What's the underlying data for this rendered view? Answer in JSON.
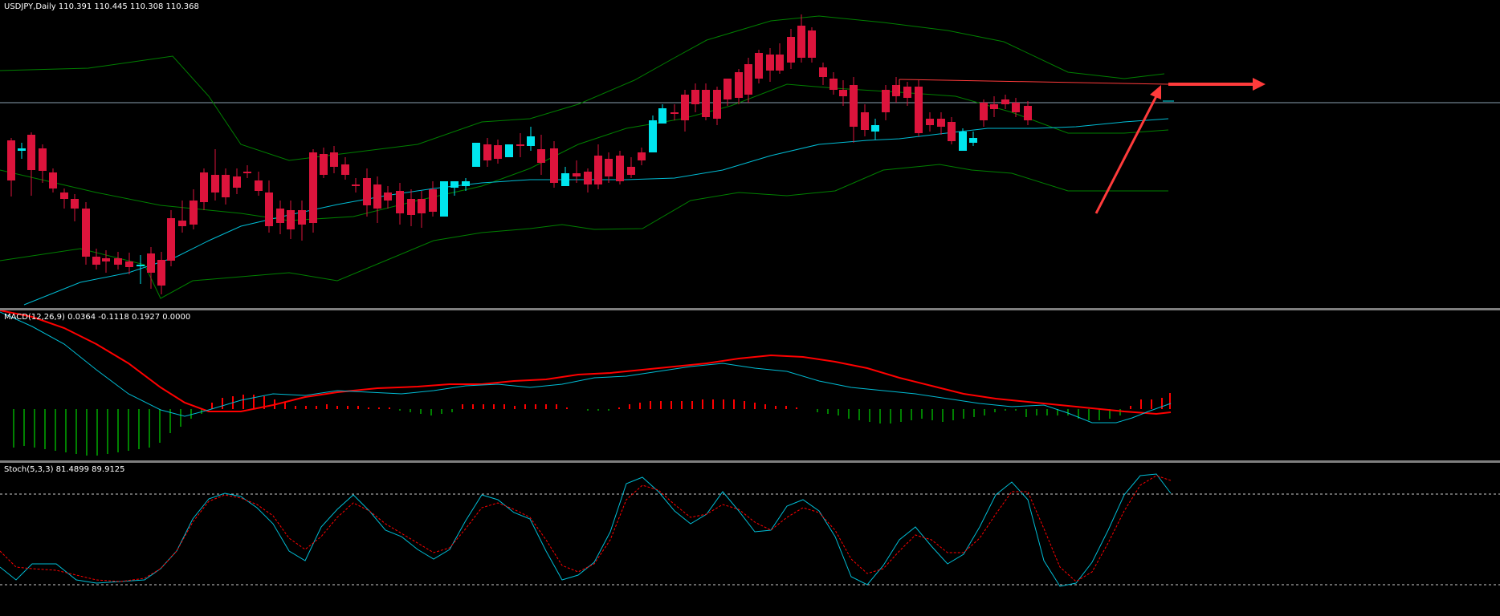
{
  "main_chart": {
    "label": "USDJPY,Daily  110.391 110.445 110.308 110.368",
    "symbol": "USDJPY",
    "timeframe": "Daily",
    "ohlc": [
      110.391,
      110.445,
      110.308,
      110.368
    ]
  },
  "macd_pane": {
    "label": "MACD(12,26,9) 0.0364 -0.1118 0.1927 0.0000"
  },
  "stoch_pane": {
    "label": "Stoch(5,3,3) 81.4899 89.9125"
  },
  "colors": {
    "bull": "#00e5ee",
    "bear": "#dc143c",
    "bands": "#008000",
    "ma": "#00bcd4",
    "signal": "#ff0000",
    "hist_pos": "#ff0000",
    "hist_neg": "#008000",
    "annotation": "#ff3b3b"
  }
}
